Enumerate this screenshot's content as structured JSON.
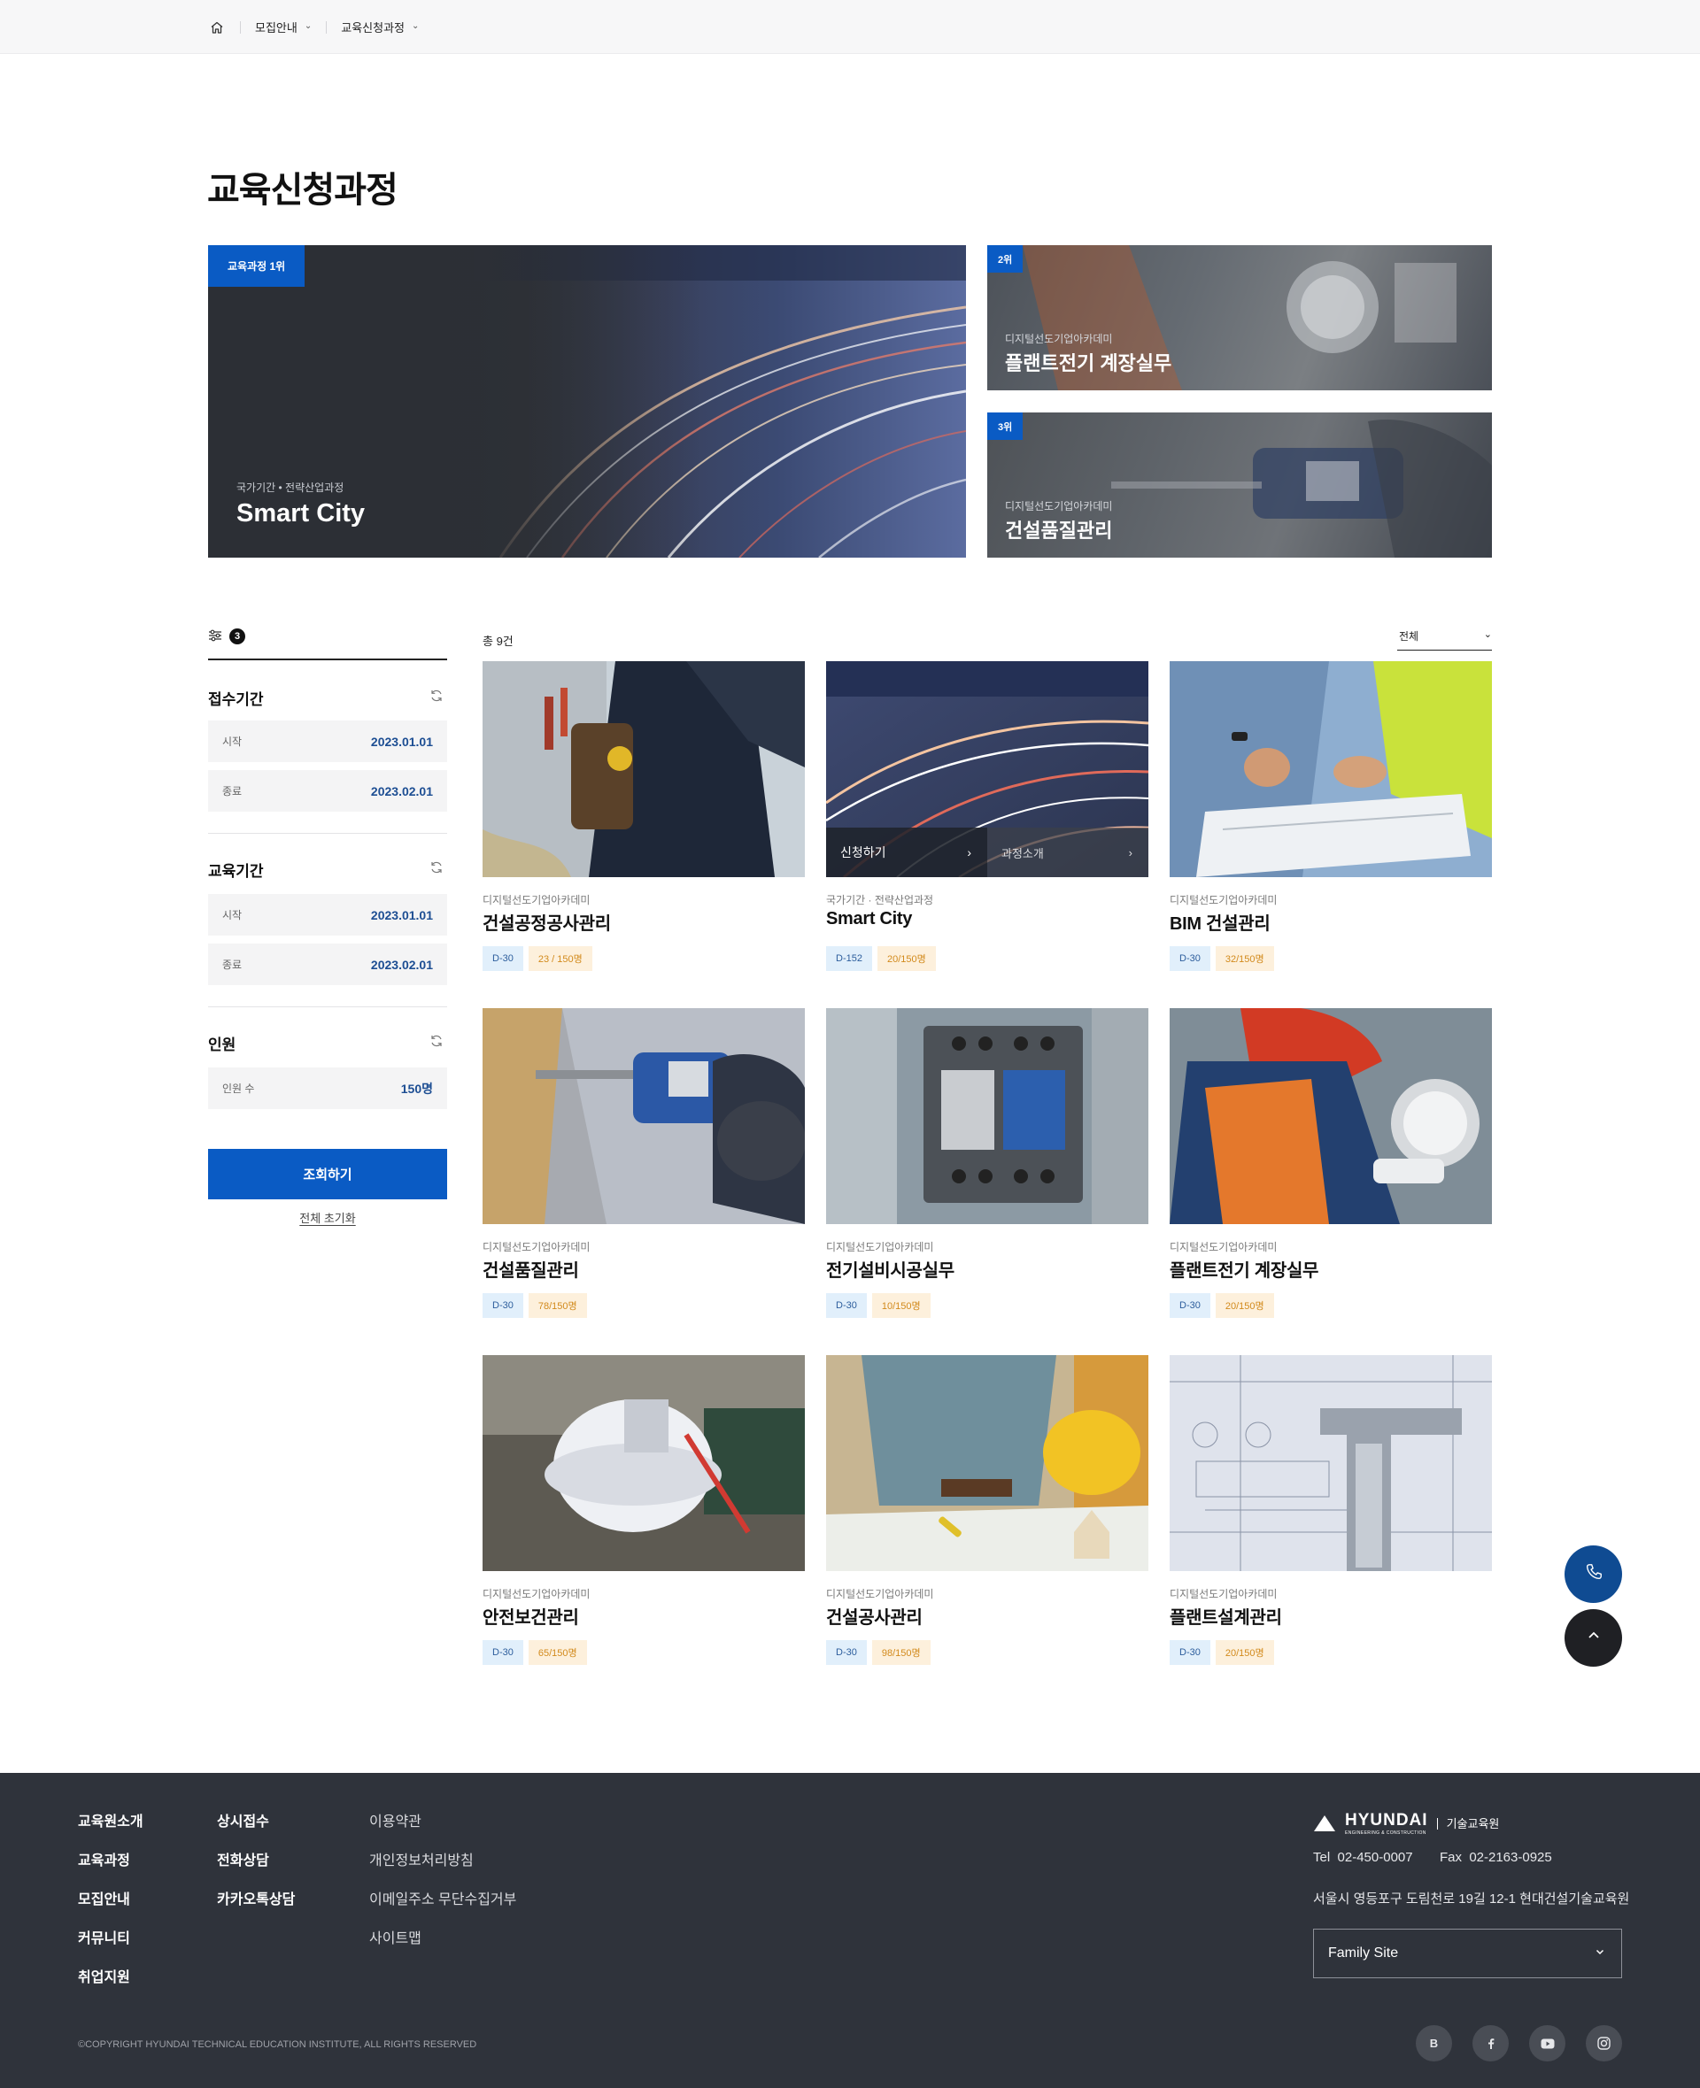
{
  "breadcrumb": {
    "menu1": "모집안내",
    "menu2": "교육신청과정"
  },
  "page_title": "교육신청과정",
  "hero": {
    "main": {
      "rank": "교육과정 1위",
      "category": "국가기간 • 전략산업과정",
      "title": "Smart City"
    },
    "second": {
      "rank": "2위",
      "category": "디지털선도기업아카데미",
      "title": "플랜트전기 계장실무"
    },
    "third": {
      "rank": "3위",
      "category": "디지털선도기업아카데미",
      "title": "건설품질관리"
    }
  },
  "filter": {
    "count": "3",
    "reception": {
      "label": "접수기간",
      "start_label": "시작",
      "start": "2023.01.01",
      "end_label": "종료",
      "end": "2023.02.01"
    },
    "education": {
      "label": "교육기간",
      "start_label": "시작",
      "start": "2023.01.01",
      "end_label": "종료",
      "end": "2023.02.01"
    },
    "people": {
      "label": "인원",
      "count_label": "인원 수",
      "count": "150명"
    },
    "search_button": "조회하기",
    "reset_all": "전체 초기화"
  },
  "list": {
    "total": "총 9건",
    "sort_value": "전체",
    "overlay": {
      "apply": "신청하기",
      "intro": "과정소개"
    },
    "cards": [
      {
        "category": "디지털선도기업아카데미",
        "title": "건설공정공사관리",
        "dday": "D-30",
        "capacity": "23 / 150명"
      },
      {
        "category": "국가기간 · 전략산업과정",
        "title": "Smart City",
        "dday": "D-152",
        "capacity": "20/150명"
      },
      {
        "category": "디지털선도기업아카데미",
        "title": "BIM 건설관리",
        "dday": "D-30",
        "capacity": "32/150명"
      },
      {
        "category": "디지털선도기업아카데미",
        "title": "건설품질관리",
        "dday": "D-30",
        "capacity": "78/150명"
      },
      {
        "category": "디지털선도기업아카데미",
        "title": "전기설비시공실무",
        "dday": "D-30",
        "capacity": "10/150명"
      },
      {
        "category": "디지털선도기업아카데미",
        "title": "플랜트전기 계장실무",
        "dday": "D-30",
        "capacity": "20/150명"
      },
      {
        "category": "디지털선도기업아카데미",
        "title": "안전보건관리",
        "dday": "D-30",
        "capacity": "65/150명"
      },
      {
        "category": "디지털선도기업아카데미",
        "title": "건설공사관리",
        "dday": "D-30",
        "capacity": "98/150명"
      },
      {
        "category": "디지털선도기업아카데미",
        "title": "플랜트설계관리",
        "dday": "D-30",
        "capacity": "20/150명"
      }
    ]
  },
  "footer": {
    "col1": [
      "교육원소개",
      "교육과정",
      "모집안내",
      "커뮤니티",
      "취업지원"
    ],
    "col2": [
      "상시접수",
      "전화상담",
      "카카오톡상담"
    ],
    "col3": [
      "이용약관",
      "개인정보처리방침",
      "이메일주소 무단수집거부",
      "사이트맵"
    ],
    "brand": {
      "logo": "HYUNDAI",
      "logo_sub": "ENGINEERING & CONSTRUCTION",
      "name": "기술교육원"
    },
    "tel_label": "Tel",
    "tel": "02-450-0007",
    "fax_label": "Fax",
    "fax": "02-2163-0925",
    "address": "서울시 영등포구 도림천로 19길 12-1 현대건설기술교육원",
    "family_site": "Family Site",
    "copyright": "©COPYRIGHT HYUNDAI TECHNICAL EDUCATION INSTITUTE, ALL RIGHTS RESERVED",
    "social": [
      "blog-icon",
      "facebook-icon",
      "youtube-icon",
      "instagram-icon"
    ],
    "blog_letter": "B"
  },
  "colors": {
    "primary": "#0a5bc4",
    "navy": "#0f4b92",
    "footer_bg": "#2f333b"
  }
}
